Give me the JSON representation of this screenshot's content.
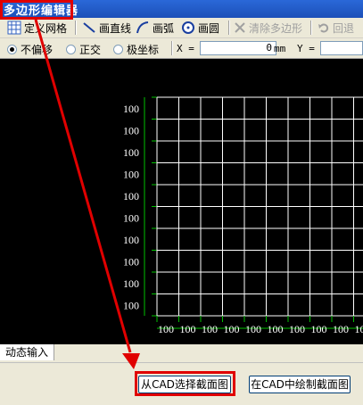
{
  "window": {
    "title": "多边形编辑器"
  },
  "toolbar": {
    "define_grid": "定义网格",
    "draw_line": "画直线",
    "draw_arc": "画弧",
    "draw_circle": "画圆",
    "clear_polygon": "清除多边形",
    "undo": "回退"
  },
  "snap": {
    "no_offset": "不偏移",
    "ortho": "正交",
    "polar": "极坐标",
    "x_label": "X =",
    "x_value": "0",
    "unit": "mm",
    "y_label": "Y ="
  },
  "grid": {
    "row_label": "100",
    "col_label": "100",
    "row_count": 10,
    "col_count": 10
  },
  "status": {
    "tab_label": "动态输入"
  },
  "footer": {
    "select_from_cad": "从CAD选择截面图",
    "draw_in_cad": "在CAD中绘制截面图"
  },
  "colors": {
    "highlight": "#e00000",
    "grid_line": "#ffffff",
    "grid_tick": "#00c000"
  }
}
